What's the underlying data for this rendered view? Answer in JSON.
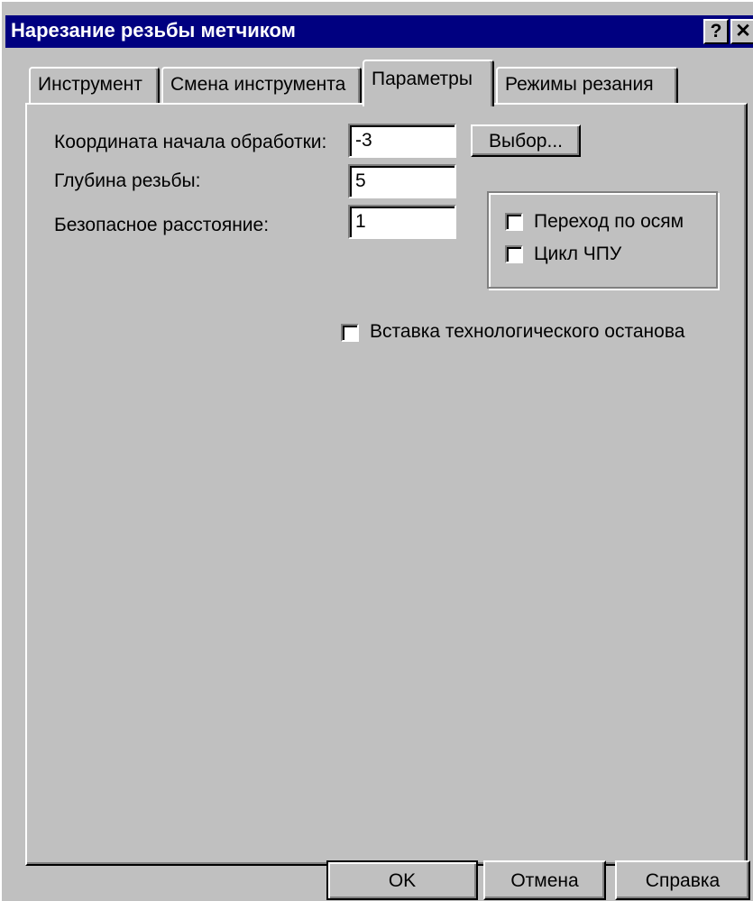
{
  "window": {
    "title": "Нарезание резьбы метчиком",
    "help_glyph": "?",
    "close_glyph": "✕"
  },
  "tabs": [
    {
      "label": "Инструмент"
    },
    {
      "label": "Смена инструмента"
    },
    {
      "label": "Параметры",
      "active": true
    },
    {
      "label": "Режимы резания"
    }
  ],
  "params": {
    "start_coord_label": "Координата начала обработки:",
    "start_coord_value": "-3",
    "select_button": "Выбор...",
    "depth_label": "Глубина резьбы:",
    "depth_value": "5",
    "safe_dist_label": "Безопасное расстояние:",
    "safe_dist_value": "1"
  },
  "options": {
    "axis_transition": "Переход по осям",
    "cnc_cycle": "Цикл ЧПУ",
    "tech_stop": "Вставка технологического останова"
  },
  "footer": {
    "ok": "OK",
    "cancel": "Отмена",
    "help": "Справка"
  }
}
